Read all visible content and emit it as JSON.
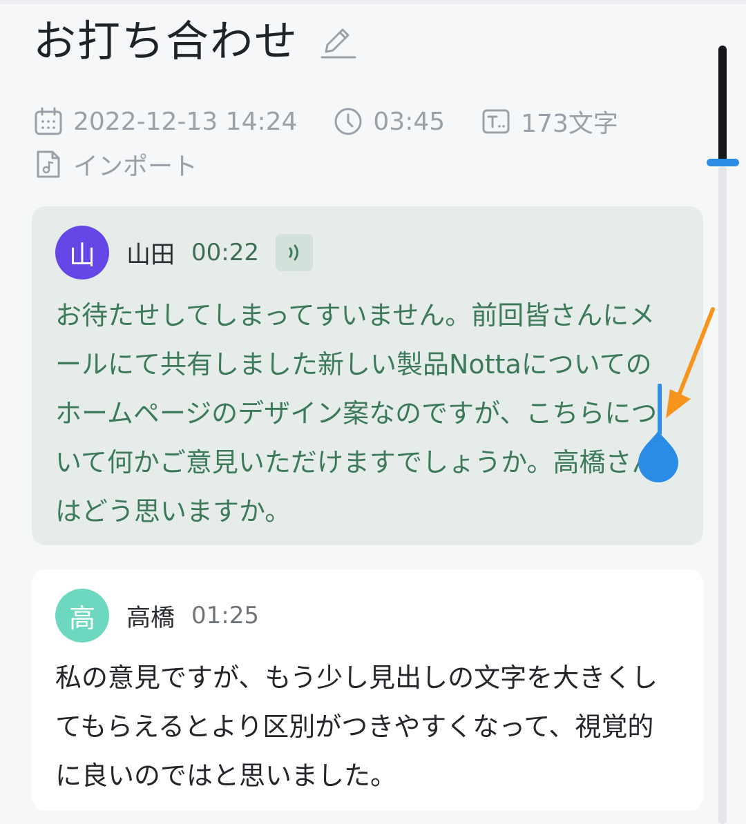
{
  "header": {
    "title": "お打ち合わせ"
  },
  "meta": {
    "datetime": "2022-12-13 14:24",
    "duration": "03:45",
    "char_count": "173文字",
    "source": "インポート"
  },
  "transcript": [
    {
      "avatar": "山",
      "avatar_color": "#6447e6",
      "speaker": "山田",
      "time": "00:22",
      "text": "お待たせしてしまってすいません。前回皆さんにメールにて共有しました新しい製品Nottaについてのホームページのデザイン案なのですが、こちらについて何かご意見いただけますでしょうか。高橋さんはどう思いますか。"
    },
    {
      "avatar": "高",
      "avatar_color": "#6dd8bf",
      "speaker": "高橋",
      "time": "01:25",
      "text": "私の意見ですが、もう少し見出しの文字を大きくしてもらえるとより区別がつきやすくなって、視覚的に良いのではと思いました。"
    }
  ],
  "colors": {
    "accent": "#2b8ce6",
    "annotation_arrow": "#f7941d",
    "active_text": "#3d7a5a",
    "active_bg": "#e6ecea"
  },
  "icons": [
    "edit-pencil-icon",
    "calendar-icon",
    "clock-icon",
    "text-count-icon",
    "music-file-icon",
    "audio-wave-icon"
  ]
}
